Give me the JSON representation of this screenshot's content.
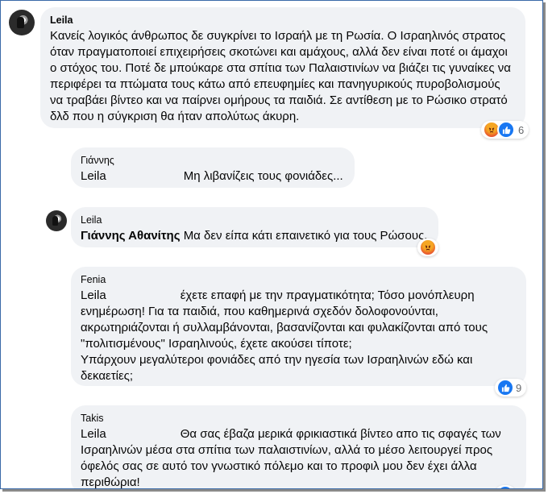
{
  "comments": [
    {
      "author": "Leila",
      "text": "Κανείς λογικός άνθρωπος δε συγκρίνει το Ισραήλ με τη Ρωσία. Ο Ισραηλινός στρατος όταν πραγματοποιεί επιχειρήσεις σκοτώνει και αμάχους, αλλά δεν είναι ποτέ οι άμαχοι ο στόχος του. Ποτέ δε μπούκαρε στα σπίτια των Παλαιστινίων να βιάζει τις γυναίκες να περιφέρει τα πτώματα τους κάτω από επευφημίες και πανηγυρικούς πυροβολισμούς να τραβάει βίντεο και να παίρνει ομήρους τα παιδιά. Σε αντίθεση με το Ρώσικο στρατό δλδ που η σύγκριση θα ήταν απολύτως άκυρη.",
      "reaction_count": "6"
    },
    {
      "author": "Γιάννης",
      "mention": "Leila",
      "text": "Μη λιβανίζεις τους φονιάδες..."
    },
    {
      "author": "Leila",
      "mention": "Γιάννης Αθανίτης",
      "text": "Μα δεν είπα κάτι επαινετικό για τους Ρώσους."
    },
    {
      "author": "Fenia",
      "mention": "Leila",
      "text_first": "έχετε επαφή με την πραγματικότητα; Τόσο μονόπλευρη ενημέρωση! Για τα παιδιά, που καθημερινά σχεδόν δολοφονούνται, ακρωτηριάζονται ή συλλαμβάνονται, βασανίζονται και φυλακίζονται από τους \"πολιτισμένους\" Ισραηλινούς, έχετε ακούσει τίποτε;",
      "text_second": "Υπάρχουν μεγαλύτεροι φονιάδες από την ηγεσία των Ισραηλινών εδώ και δεκαετίες;",
      "reaction_count": "9"
    },
    {
      "author": "Takis",
      "mention": "Leila",
      "text": "Θα σας έβαζα μερικά φρικιαστικά βίντεο απο τις σφαγές των Ισραηλινών μέσα στα σπίτια των παλαιστινίων, αλλά το μέσο λειτουργεί προς όφελός σας σε αυτό τον γνωστικό πόλεμο και το προφιλ μου δεν έχει άλλα περιθώρια!"
    }
  ],
  "icons": {
    "angry_reaction": "angry-face",
    "like_reaction": "thumbs-up"
  },
  "colors": {
    "bubble": "#f0f2f5",
    "like_blue": "#1877f2",
    "angry_orange": "#e8542f",
    "meta_grey": "#65676b"
  }
}
